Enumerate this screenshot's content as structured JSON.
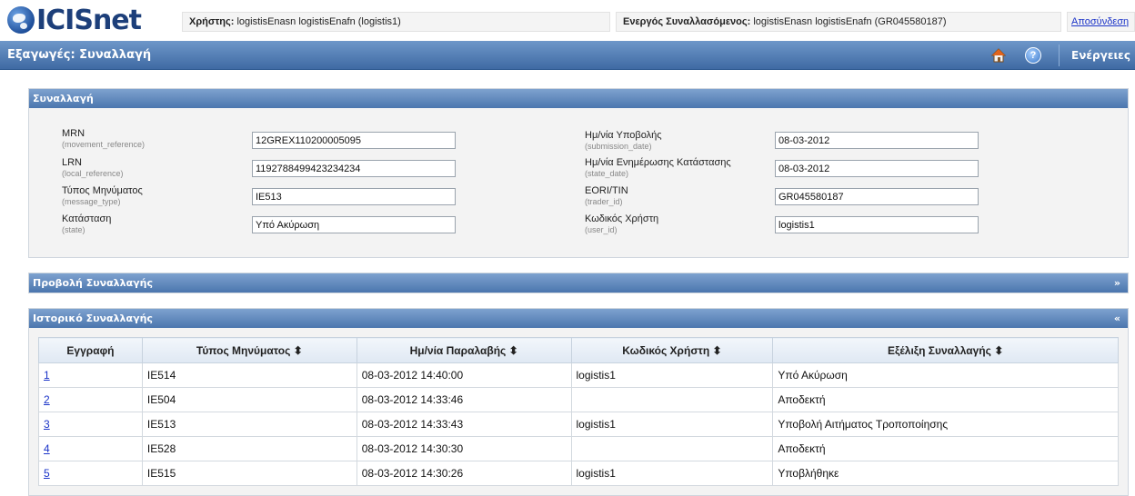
{
  "header": {
    "logo_text": "ICISnet",
    "user_label": "Χρήστης:",
    "user_value": "logistisEnasn logistisEnafn (logistis1)",
    "active_label": "Ενεργός Συναλλασόμενος:",
    "active_value": "logistisEnasn logistisEnafn (GR045580187)",
    "logout": "Αποσύνδεση"
  },
  "titlebar": {
    "title": "Εξαγωγές: Συναλλαγή",
    "help": "?",
    "actions": "Ενέργειες",
    "home_icon": "home-icon",
    "help_icon": "help-icon"
  },
  "transaction_panel": {
    "title": "Συναλλαγή",
    "left_fields": [
      {
        "label": "MRN",
        "sub": "(movement_reference)",
        "value": "12GREX110200005095"
      },
      {
        "label": "LRN",
        "sub": "(local_reference)",
        "value": "1192788499423234234"
      },
      {
        "label": "Τύπος Μηνύματος",
        "sub": "(message_type)",
        "value": "IE513"
      },
      {
        "label": "Κατάσταση",
        "sub": "(state)",
        "value": "Υπό Ακύρωση"
      }
    ],
    "right_fields": [
      {
        "label": "Ημ/νία Υποβολής",
        "sub": "(submission_date)",
        "value": "08-03-2012"
      },
      {
        "label": "Ημ/νία Ενημέρωσης Κατάστασης",
        "sub": "(state_date)",
        "value": "08-03-2012"
      },
      {
        "label": "EORI/TIN",
        "sub": "(trader_id)",
        "value": "GR045580187"
      },
      {
        "label": "Κωδικός Χρήστη",
        "sub": "(user_id)",
        "value": "logistis1"
      }
    ]
  },
  "view_panel": {
    "title": "Προβολή Συναλλαγής",
    "toggle": "»"
  },
  "history_panel": {
    "title": "Ιστορικό Συναλλαγής",
    "toggle": "«",
    "columns": [
      "Εγγραφή",
      "Τύπος Μηνύματος ⬍",
      "Ημ/νία Παραλαβής ⬍",
      "Κωδικός Χρήστη ⬍",
      "Εξέλιξη Συναλλαγής ⬍"
    ],
    "rows": [
      {
        "id": "1",
        "type": "IE514",
        "date": "08-03-2012 14:40:00",
        "user": "logistis1",
        "status": "Υπό Ακύρωση"
      },
      {
        "id": "2",
        "type": "IE504",
        "date": "08-03-2012 14:33:46",
        "user": "",
        "status": "Αποδεκτή"
      },
      {
        "id": "3",
        "type": "IE513",
        "date": "08-03-2012 14:33:43",
        "user": "logistis1",
        "status": "Υποβολή Αιτήματος Τροποποίησης"
      },
      {
        "id": "4",
        "type": "IE528",
        "date": "08-03-2012 14:30:30",
        "user": "",
        "status": "Αποδεκτή"
      },
      {
        "id": "5",
        "type": "IE515",
        "date": "08-03-2012 14:30:26",
        "user": "logistis1",
        "status": "Υποβλήθηκε"
      }
    ]
  }
}
